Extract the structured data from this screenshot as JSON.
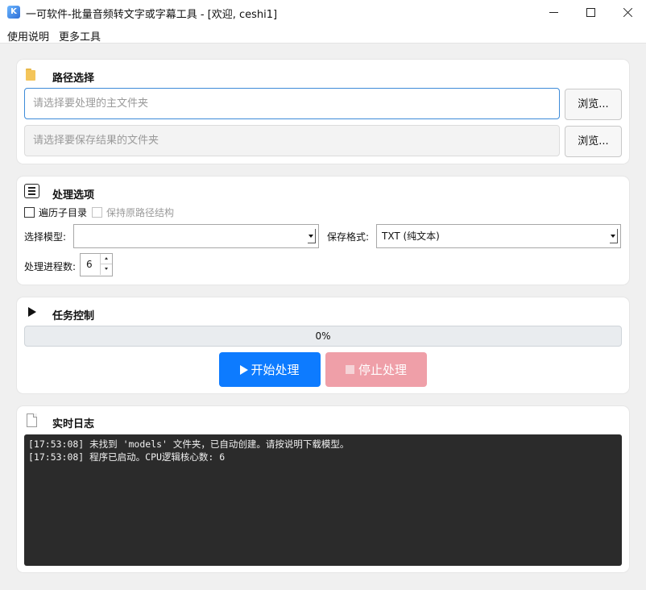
{
  "window": {
    "title": "一可软件-批量音频转文字或字幕工具 - [欢迎, ceshi1]",
    "icon": "app-icon"
  },
  "menu": {
    "items": [
      {
        "label": "使用说明"
      },
      {
        "label": "更多工具"
      }
    ]
  },
  "path_section": {
    "title": "路径选择",
    "icon": "folder-icon",
    "main_folder_placeholder": "请选择要处理的主文件夹",
    "main_folder_value": "",
    "save_folder_placeholder": "请选择要保存结果的文件夹",
    "browse_label_1": "浏览...",
    "browse_label_2": "浏览..."
  },
  "options_section": {
    "title": "处理选项",
    "icon": "list-icon",
    "recurse_label": "遍历子目录",
    "recurse_checked": false,
    "keep_structure_label": "保持原路径结构",
    "keep_structure_checked": false,
    "keep_structure_enabled": false,
    "model_label": "选择模型:",
    "model_value": "",
    "format_label": "保存格式:",
    "format_value": "TXT (纯文本)",
    "process_label": "处理进程数:",
    "process_value": "6"
  },
  "task_section": {
    "title": "任务控制",
    "icon": "play-icon",
    "progress_percent": 0,
    "progress_text": "0%",
    "start_label": "开始处理",
    "stop_label": "停止处理",
    "start_color": "#0d7bff",
    "stop_color": "#ef9fa8"
  },
  "log_section": {
    "title": "实时日志",
    "icon": "document-icon",
    "lines": [
      "[17:53:08] 未找到 'models' 文件夹，已自动创建。请按说明下载模型。",
      "[17:53:08] 程序已启动。CPU逻辑核心数: 6"
    ]
  }
}
